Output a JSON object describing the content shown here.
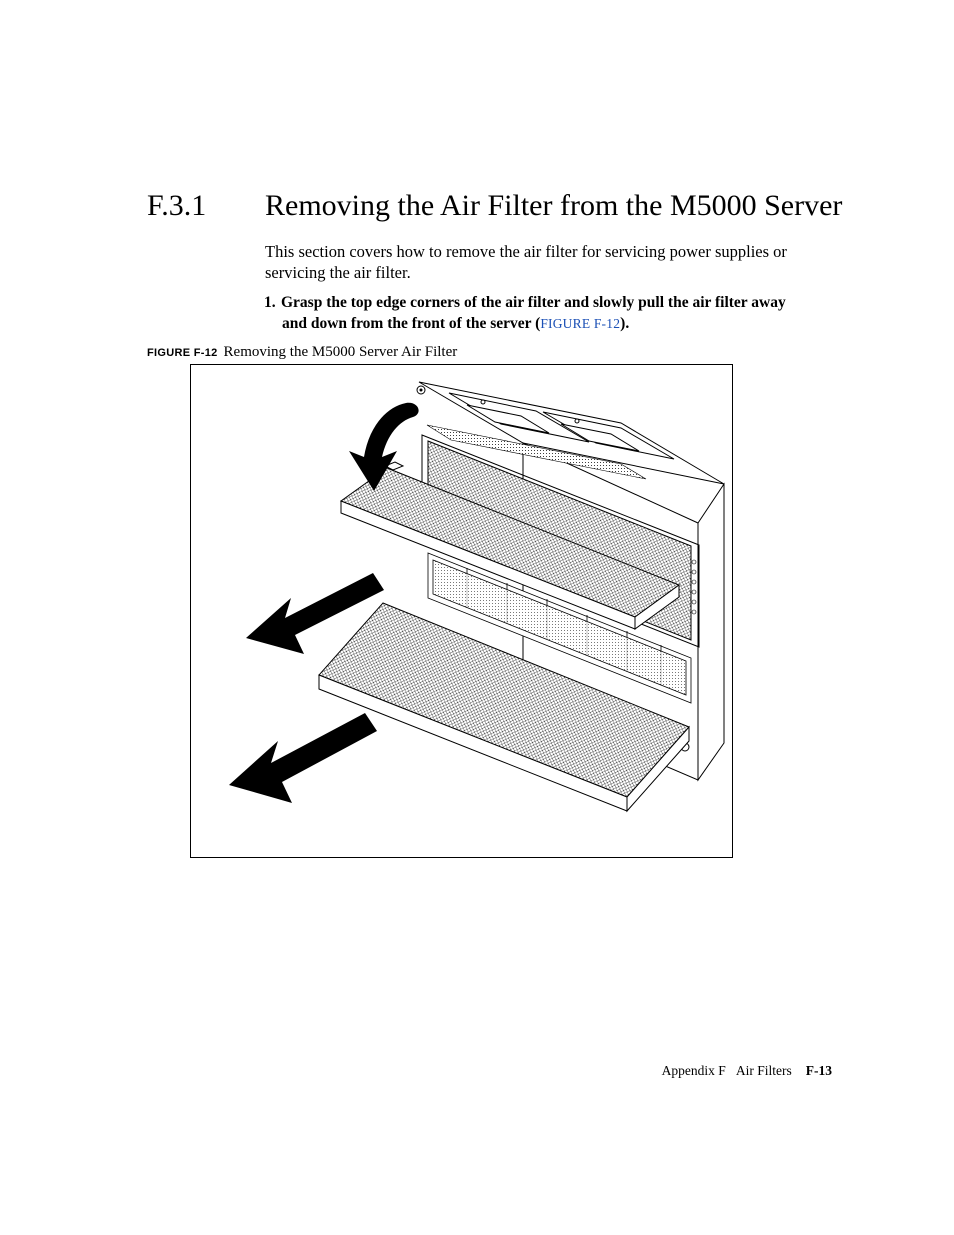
{
  "section": {
    "number": "F.3.1",
    "title": "Removing the Air Filter from the M5000 Server",
    "intro": "This section covers how to remove the air filter for servicing power supplies or servicing the air filter.",
    "step1_line1": "Grasp the top edge corners of the air filter and slowly pull the air filter away",
    "step1_line2_a": "and down from the front of the server (",
    "step1_figref": "FIGURE F-12",
    "step1_line2_b": ")."
  },
  "figure": {
    "label_prefix": "FIGURE F-12",
    "caption": "Removing the M5000 Server Air Filter"
  },
  "footer": {
    "appendix": "Appendix F",
    "chapter": "Air Filters",
    "pagenum": "F-13"
  }
}
